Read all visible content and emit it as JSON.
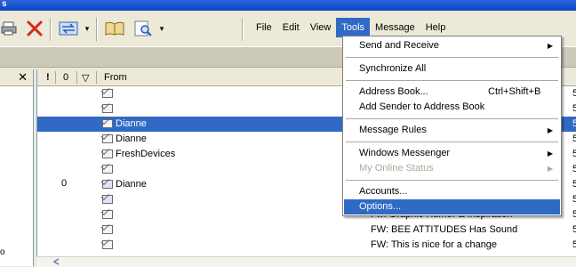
{
  "window": {
    "title_fragment": "s"
  },
  "toolbar": {
    "buttons": [
      {
        "name": "print-icon",
        "glyph": "🖨"
      },
      {
        "name": "delete-icon",
        "glyph": "✕",
        "color": "#d42a1a"
      },
      {
        "name": "send-receive-icon",
        "glyph": "⇄",
        "color": "#2b5fb5"
      },
      {
        "name": "addresses-icon",
        "glyph": "📖"
      },
      {
        "name": "find-icon",
        "glyph": "🔍"
      }
    ],
    "dropdown_arrow": "▾"
  },
  "menubar": {
    "items": [
      {
        "label": "File",
        "active": false
      },
      {
        "label": "Edit",
        "active": false
      },
      {
        "label": "View",
        "active": false
      },
      {
        "label": "Tools",
        "active": true
      },
      {
        "label": "Message",
        "active": false
      },
      {
        "label": "Help",
        "active": false
      }
    ]
  },
  "folder_pane": {
    "close_glyph": "✕",
    "fragment_text": "o"
  },
  "message_list": {
    "headers": {
      "priority": "!",
      "attachment": "0",
      "flag": "▽",
      "from": "From"
    },
    "rows": [
      {
        "from": "",
        "attach": "",
        "subject": "",
        "num": "5",
        "selected": false,
        "icon": "read"
      },
      {
        "from": "",
        "attach": "",
        "subject": "",
        "num": "5",
        "selected": false,
        "icon": "read"
      },
      {
        "from": "Dianne",
        "attach": "",
        "subject": "",
        "num": "5",
        "selected": true,
        "icon": "read"
      },
      {
        "from": "Dianne",
        "attach": "",
        "subject": "",
        "num": "5",
        "selected": false,
        "icon": "read"
      },
      {
        "from": "FreshDevices",
        "attach": "",
        "subject": "",
        "num": "5",
        "selected": false,
        "icon": "read"
      },
      {
        "from": "",
        "attach": "",
        "subject": "",
        "num": "5",
        "selected": false,
        "icon": "read"
      },
      {
        "from": "Dianne",
        "attach": "0",
        "subject": "",
        "num": "5",
        "selected": false,
        "icon": "forward"
      },
      {
        "from": "",
        "attach": "",
        "subject": "",
        "num": "5",
        "selected": false,
        "icon": "forward"
      },
      {
        "from": "",
        "attach": "",
        "subject": "Fw: Graphic Humor & Inspiration",
        "num": "5",
        "selected": false,
        "icon": "read"
      },
      {
        "from": "",
        "attach": "",
        "subject": "FW: BEE ATTITUDES Has Sound",
        "num": "5",
        "selected": false,
        "icon": "read"
      },
      {
        "from": "",
        "attach": "",
        "subject": "FW: This is nice for a change",
        "num": "5",
        "selected": false,
        "icon": "read"
      }
    ]
  },
  "tools_menu": {
    "items": [
      {
        "label": "Send and Receive",
        "shortcut": "",
        "submenu": true,
        "disabled": false,
        "selected": false
      },
      {
        "sep": true
      },
      {
        "label": "Synchronize All",
        "shortcut": "",
        "submenu": false,
        "disabled": false,
        "selected": false
      },
      {
        "sep": true
      },
      {
        "label": "Address Book...",
        "shortcut": "Ctrl+Shift+B",
        "submenu": false,
        "disabled": false,
        "selected": false
      },
      {
        "label": "Add Sender to Address Book",
        "shortcut": "",
        "submenu": false,
        "disabled": false,
        "selected": false
      },
      {
        "sep": true
      },
      {
        "label": "Message Rules",
        "shortcut": "",
        "submenu": true,
        "disabled": false,
        "selected": false
      },
      {
        "sep": true
      },
      {
        "label": "Windows Messenger",
        "shortcut": "",
        "submenu": true,
        "disabled": false,
        "selected": false
      },
      {
        "label": "My Online Status",
        "shortcut": "",
        "submenu": true,
        "disabled": true,
        "selected": false
      },
      {
        "sep": true
      },
      {
        "label": "Accounts...",
        "shortcut": "",
        "submenu": false,
        "disabled": false,
        "selected": false
      },
      {
        "label": "Options...",
        "shortcut": "",
        "submenu": false,
        "disabled": false,
        "selected": true
      }
    ],
    "submenu_arrow": "▶"
  },
  "colors": {
    "selection": "#316AC5",
    "chrome": "#ECE9D8",
    "band": "#CCC9B8"
  }
}
